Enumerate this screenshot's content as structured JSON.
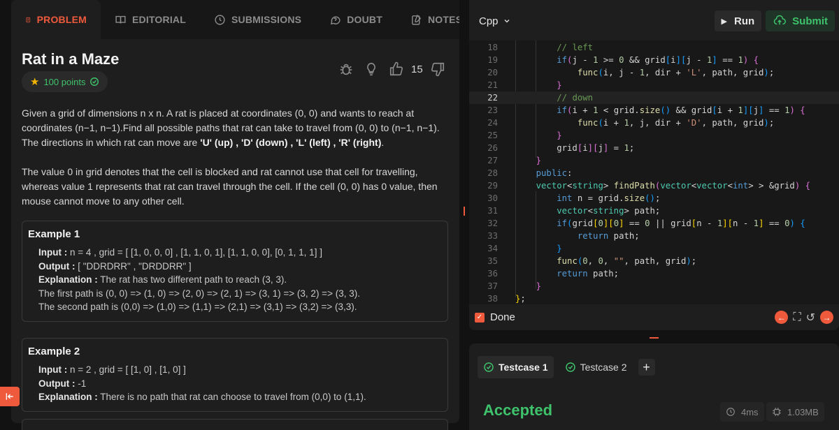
{
  "tabs": [
    {
      "label": "PROBLEM",
      "icon": "document-icon"
    },
    {
      "label": "EDITORIAL",
      "icon": "book-icon"
    },
    {
      "label": "SUBMISSIONS",
      "icon": "clock-icon"
    },
    {
      "label": "DOUBT",
      "icon": "chat-icon"
    },
    {
      "label": "NOTES",
      "icon": "notes-icon"
    }
  ],
  "problem": {
    "title": "Rat in a Maze",
    "points": "100 points",
    "likes": "15",
    "description": [
      "Given a grid of dimensions n x n. A rat is placed at coordinates (0, 0) and wants to reach at coordinates (n−1, n−1).Find all possible paths that rat can take to travel from (0, 0) to (n−1, n−1). The directions in which rat can move are ",
      "'U' (up) , 'D' (down) , 'L' (left) , 'R' (right)",
      ".",
      "The value 0 in grid denotes that the cell is blocked and rat cannot use that cell for travelling, whereas value 1 represents that rat can travel through the cell. If the cell (0, 0) has 0 value, then mouse cannot move to any other cell."
    ],
    "examples": [
      {
        "title": "Example 1",
        "input_label": "Input :",
        "input": " n = 4 , grid = [ [1, 0, 0, 0] , [1, 1, 0, 1], [1, 1, 0, 0], [0, 1, 1, 1] ]",
        "output_label": "Output :",
        "output": " [ \"DDRDRR\" , \"DRDDRR\" ]",
        "explanation_label": "Explanation :",
        "explanation": " The rat has two different path to reach (3, 3).",
        "extra": [
          "The first path is (0, 0) => (1, 0) => (2, 0) => (2, 1) => (3, 1) => (3, 2) => (3, 3).",
          "The second path is (0,0) => (1,0) => (1,1) => (2,1) => (3,1) => (3,2) => (3,3)."
        ]
      },
      {
        "title": "Example 2",
        "input_label": "Input :",
        "input": " n = 2 , grid = [ [1, 0] , [1, 0] ]",
        "output_label": "Output :",
        "output": " -1",
        "explanation_label": "Explanation :",
        "explanation": " There is no path that rat can choose to travel from (0,0) to (1,1)."
      }
    ]
  },
  "editor": {
    "language": "Cpp",
    "run_label": "Run",
    "submit_label": "Submit",
    "done_label": "Done"
  },
  "tests": {
    "cases": [
      "Testcase 1",
      "Testcase 2"
    ],
    "add_label": "+",
    "status": "Accepted",
    "time": "4ms",
    "memory": "1.03MB"
  },
  "colors": {
    "accent": "#f05a3c",
    "success": "#3ec26b",
    "panel": "#1e1e1e",
    "background": "#121212"
  }
}
